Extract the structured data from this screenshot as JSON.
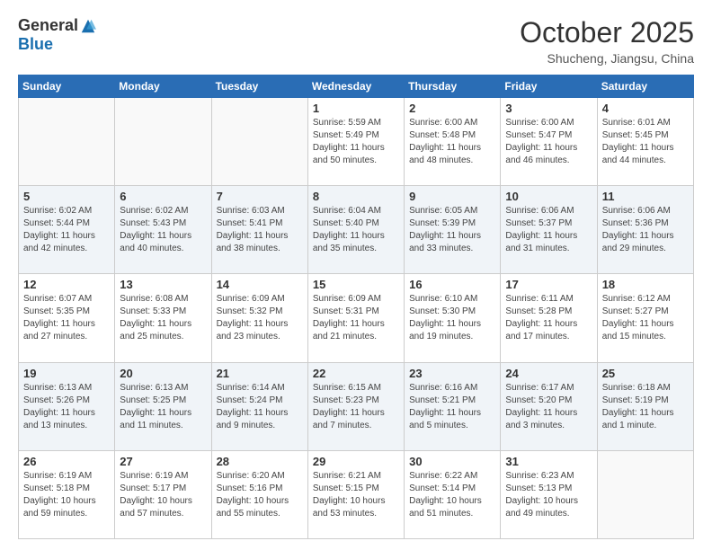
{
  "header": {
    "logo_general": "General",
    "logo_blue": "Blue",
    "month_title": "October 2025",
    "location": "Shucheng, Jiangsu, China"
  },
  "days_of_week": [
    "Sunday",
    "Monday",
    "Tuesday",
    "Wednesday",
    "Thursday",
    "Friday",
    "Saturday"
  ],
  "weeks": [
    {
      "shaded": false,
      "days": [
        {
          "num": "",
          "info": ""
        },
        {
          "num": "",
          "info": ""
        },
        {
          "num": "",
          "info": ""
        },
        {
          "num": "1",
          "info": "Sunrise: 5:59 AM\nSunset: 5:49 PM\nDaylight: 11 hours\nand 50 minutes."
        },
        {
          "num": "2",
          "info": "Sunrise: 6:00 AM\nSunset: 5:48 PM\nDaylight: 11 hours\nand 48 minutes."
        },
        {
          "num": "3",
          "info": "Sunrise: 6:00 AM\nSunset: 5:47 PM\nDaylight: 11 hours\nand 46 minutes."
        },
        {
          "num": "4",
          "info": "Sunrise: 6:01 AM\nSunset: 5:45 PM\nDaylight: 11 hours\nand 44 minutes."
        }
      ]
    },
    {
      "shaded": true,
      "days": [
        {
          "num": "5",
          "info": "Sunrise: 6:02 AM\nSunset: 5:44 PM\nDaylight: 11 hours\nand 42 minutes."
        },
        {
          "num": "6",
          "info": "Sunrise: 6:02 AM\nSunset: 5:43 PM\nDaylight: 11 hours\nand 40 minutes."
        },
        {
          "num": "7",
          "info": "Sunrise: 6:03 AM\nSunset: 5:41 PM\nDaylight: 11 hours\nand 38 minutes."
        },
        {
          "num": "8",
          "info": "Sunrise: 6:04 AM\nSunset: 5:40 PM\nDaylight: 11 hours\nand 35 minutes."
        },
        {
          "num": "9",
          "info": "Sunrise: 6:05 AM\nSunset: 5:39 PM\nDaylight: 11 hours\nand 33 minutes."
        },
        {
          "num": "10",
          "info": "Sunrise: 6:06 AM\nSunset: 5:37 PM\nDaylight: 11 hours\nand 31 minutes."
        },
        {
          "num": "11",
          "info": "Sunrise: 6:06 AM\nSunset: 5:36 PM\nDaylight: 11 hours\nand 29 minutes."
        }
      ]
    },
    {
      "shaded": false,
      "days": [
        {
          "num": "12",
          "info": "Sunrise: 6:07 AM\nSunset: 5:35 PM\nDaylight: 11 hours\nand 27 minutes."
        },
        {
          "num": "13",
          "info": "Sunrise: 6:08 AM\nSunset: 5:33 PM\nDaylight: 11 hours\nand 25 minutes."
        },
        {
          "num": "14",
          "info": "Sunrise: 6:09 AM\nSunset: 5:32 PM\nDaylight: 11 hours\nand 23 minutes."
        },
        {
          "num": "15",
          "info": "Sunrise: 6:09 AM\nSunset: 5:31 PM\nDaylight: 11 hours\nand 21 minutes."
        },
        {
          "num": "16",
          "info": "Sunrise: 6:10 AM\nSunset: 5:30 PM\nDaylight: 11 hours\nand 19 minutes."
        },
        {
          "num": "17",
          "info": "Sunrise: 6:11 AM\nSunset: 5:28 PM\nDaylight: 11 hours\nand 17 minutes."
        },
        {
          "num": "18",
          "info": "Sunrise: 6:12 AM\nSunset: 5:27 PM\nDaylight: 11 hours\nand 15 minutes."
        }
      ]
    },
    {
      "shaded": true,
      "days": [
        {
          "num": "19",
          "info": "Sunrise: 6:13 AM\nSunset: 5:26 PM\nDaylight: 11 hours\nand 13 minutes."
        },
        {
          "num": "20",
          "info": "Sunrise: 6:13 AM\nSunset: 5:25 PM\nDaylight: 11 hours\nand 11 minutes."
        },
        {
          "num": "21",
          "info": "Sunrise: 6:14 AM\nSunset: 5:24 PM\nDaylight: 11 hours\nand 9 minutes."
        },
        {
          "num": "22",
          "info": "Sunrise: 6:15 AM\nSunset: 5:23 PM\nDaylight: 11 hours\nand 7 minutes."
        },
        {
          "num": "23",
          "info": "Sunrise: 6:16 AM\nSunset: 5:21 PM\nDaylight: 11 hours\nand 5 minutes."
        },
        {
          "num": "24",
          "info": "Sunrise: 6:17 AM\nSunset: 5:20 PM\nDaylight: 11 hours\nand 3 minutes."
        },
        {
          "num": "25",
          "info": "Sunrise: 6:18 AM\nSunset: 5:19 PM\nDaylight: 11 hours\nand 1 minute."
        }
      ]
    },
    {
      "shaded": false,
      "days": [
        {
          "num": "26",
          "info": "Sunrise: 6:19 AM\nSunset: 5:18 PM\nDaylight: 10 hours\nand 59 minutes."
        },
        {
          "num": "27",
          "info": "Sunrise: 6:19 AM\nSunset: 5:17 PM\nDaylight: 10 hours\nand 57 minutes."
        },
        {
          "num": "28",
          "info": "Sunrise: 6:20 AM\nSunset: 5:16 PM\nDaylight: 10 hours\nand 55 minutes."
        },
        {
          "num": "29",
          "info": "Sunrise: 6:21 AM\nSunset: 5:15 PM\nDaylight: 10 hours\nand 53 minutes."
        },
        {
          "num": "30",
          "info": "Sunrise: 6:22 AM\nSunset: 5:14 PM\nDaylight: 10 hours\nand 51 minutes."
        },
        {
          "num": "31",
          "info": "Sunrise: 6:23 AM\nSunset: 5:13 PM\nDaylight: 10 hours\nand 49 minutes."
        },
        {
          "num": "",
          "info": ""
        }
      ]
    }
  ]
}
